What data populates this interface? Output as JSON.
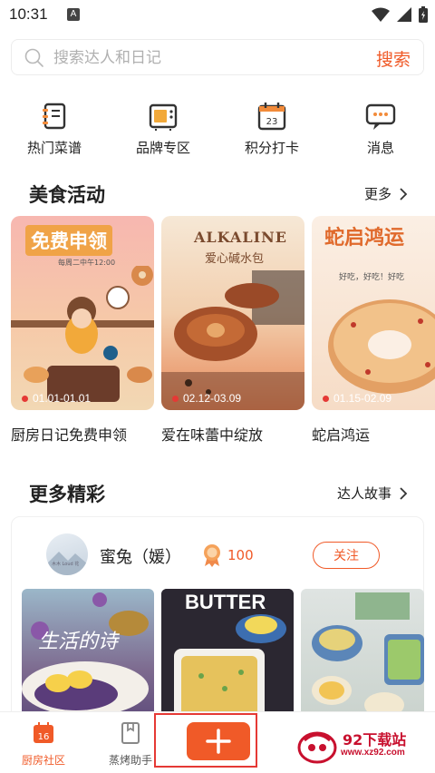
{
  "status_bar": {
    "time": "10:31",
    "notice": "A"
  },
  "search": {
    "placeholder": "搜索达人和日记",
    "value": "",
    "button_label": "搜索"
  },
  "categories": [
    {
      "label": "热门菜谱",
      "icon": "notebook-icon"
    },
    {
      "label": "品牌专区",
      "icon": "oven-icon"
    },
    {
      "label": "积分打卡",
      "icon": "calendar-icon",
      "icon_text": "23"
    },
    {
      "label": "消息",
      "icon": "chat-bubble-icon"
    }
  ],
  "food_events": {
    "title": "美食活动",
    "more_label": "更多",
    "cards": [
      {
        "poster_title": "免费申领",
        "poster_subtitle": "每周二中午12:00",
        "date": "01.01-01.01",
        "label": "厨房日记免费申领"
      },
      {
        "poster_title": "ALKALINE",
        "poster_subtitle": "爱心碱水包",
        "date": "02.12-03.09",
        "label": "爱在味蕾中绽放"
      },
      {
        "poster_title": "蛇启鸿运",
        "poster_subtitle": "好吃，好吃！好吃",
        "date": "01.15-02.09",
        "label": "蛇启鸿运"
      }
    ]
  },
  "more_highlights": {
    "title": "更多精彩",
    "more_label": "达人故事",
    "user": {
      "name": "蜜兔（媛）",
      "points": "100",
      "follow_label": "关注",
      "avatar_caption": "木木 Loud 花"
    },
    "photos": [
      {
        "caption": "生活的诗"
      },
      {
        "caption": "BUTTER"
      },
      {
        "caption": ""
      }
    ]
  },
  "bottom_nav": {
    "items": [
      {
        "label": "厨房社区",
        "icon": "calendar-16-icon",
        "icon_text": "16",
        "active": true
      },
      {
        "label": "蒸烤助手",
        "icon": "book-icon",
        "active": false
      }
    ],
    "add_icon": "plus-icon"
  },
  "watermark": {
    "name": "92下载站",
    "url": "www.xz92.com"
  },
  "colors": {
    "accent": "#f05a28",
    "text": "#222222",
    "placeholder": "#b0b0b0",
    "highlight_border": "#e53935"
  }
}
